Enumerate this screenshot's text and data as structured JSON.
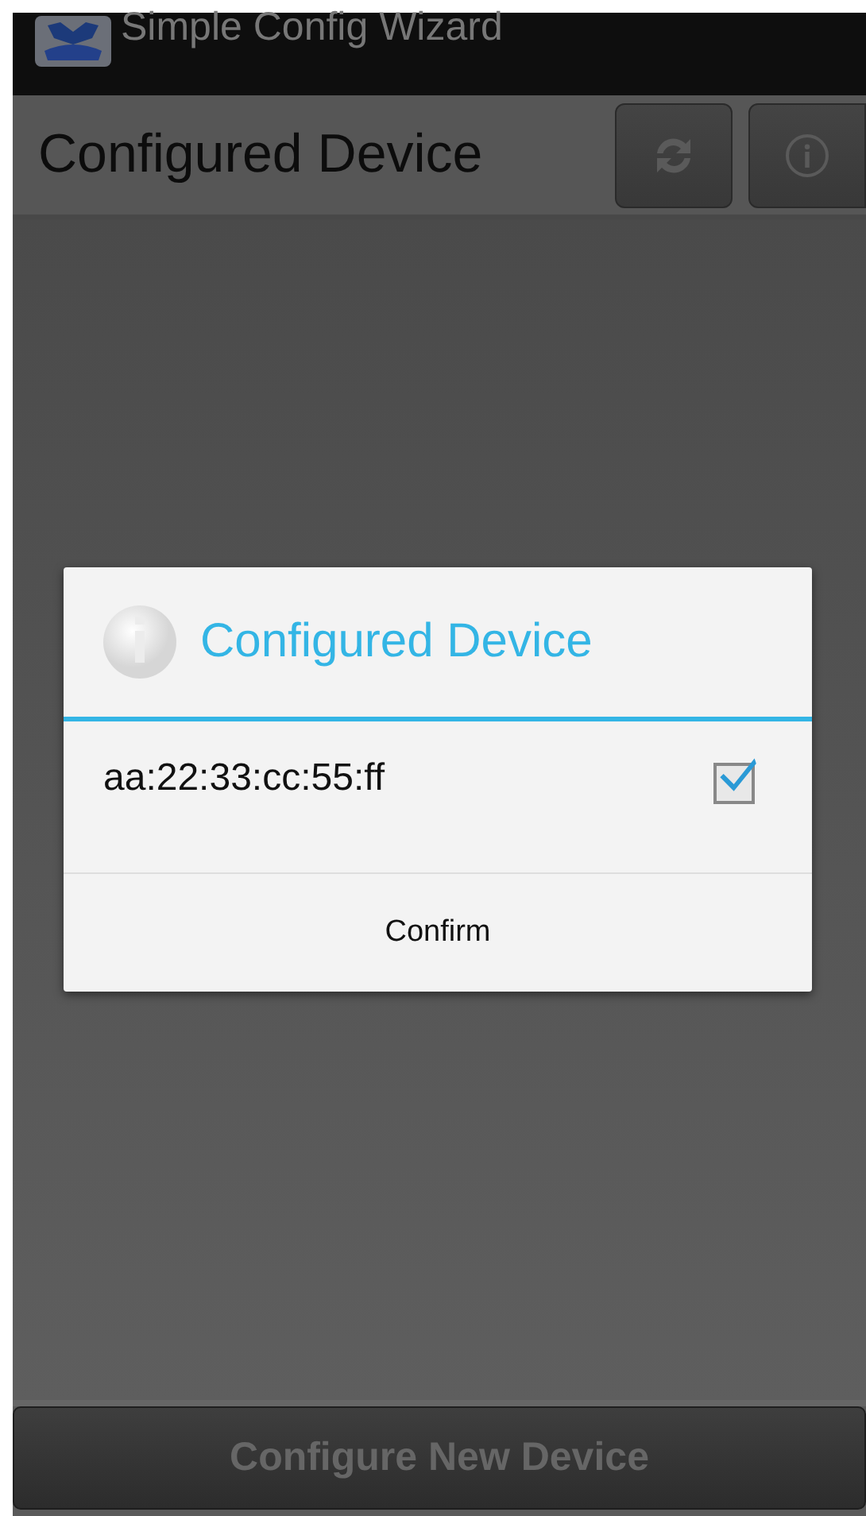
{
  "app_bar": {
    "title": "Simple Config Wizard"
  },
  "action_bar": {
    "title": "Configured Device"
  },
  "dialog": {
    "title": "Configured Device",
    "items": [
      {
        "label": "aa:22:33:cc:55:ff",
        "checked": true
      }
    ],
    "buttons": [
      "Confirm"
    ]
  },
  "bottom_button": {
    "label": "Configure New Device",
    "disabled": true
  }
}
